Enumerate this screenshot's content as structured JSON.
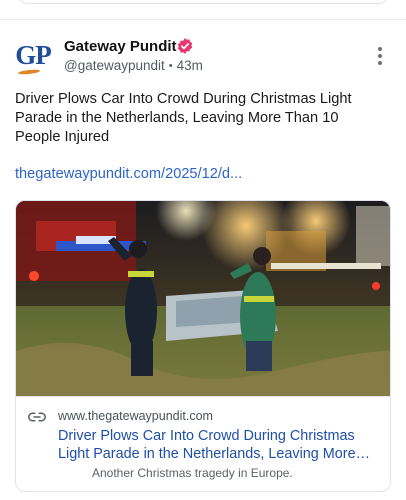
{
  "post": {
    "author": {
      "avatar_text": "GP",
      "name": "Gateway Pundit",
      "handle": "@gatewaypundit",
      "time": "43m",
      "verified_icon": "verified-badge-icon"
    },
    "text": "Driver Plows Car Into Crowd During Christmas Light Parade in the Netherlands, Leaving More Than 10 People Injured",
    "link_text": "thegatewaypundit.com/2025/12/d...",
    "more_icon": "more-vertical-icon"
  },
  "link_card": {
    "domain": "www.thegatewaypundit.com",
    "title": "Driver Plows Car Into Crowd During Christmas Light Parade in the Netherlands, Leaving More…",
    "description": "Another Christmas tragedy in Europe.",
    "link_icon": "link-icon"
  },
  "colors": {
    "brand_blue": "#1f4d96",
    "brand_orange": "#e2862a",
    "verified_pink": "#e8376e",
    "link_blue": "#2c64c6"
  }
}
